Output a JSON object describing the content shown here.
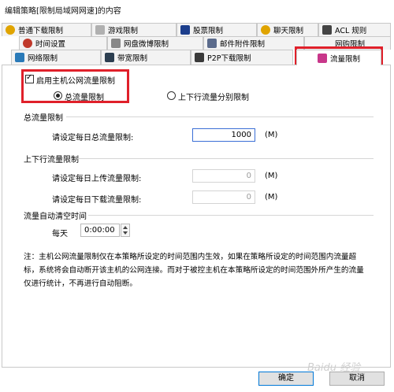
{
  "window": {
    "title": "编辑策略[限制局域网网速]的内容"
  },
  "tabs": {
    "row1": [
      {
        "label": "普通下载限制",
        "icon": "download-icon",
        "color": "#e0a400"
      },
      {
        "label": "游戏限制",
        "icon": "game-icon",
        "color": "#b0b0b0"
      },
      {
        "label": "股票限制",
        "icon": "stock-icon",
        "color": "#1c3e8c"
      },
      {
        "label": "聊天限制",
        "icon": "chat-icon",
        "color": "#e0a400"
      },
      {
        "label": "ACL 规则",
        "icon": "acl-icon",
        "color": "#444444"
      }
    ],
    "row2": [
      {
        "label": "时间设置",
        "icon": "clock-icon",
        "color": "#c0392b"
      },
      {
        "label": "网盘微博限制",
        "icon": "cloud-icon",
        "color": "#888888"
      },
      {
        "label": "邮件附件限制",
        "icon": "mail-icon",
        "color": "#5b6b8c"
      },
      {
        "label": "网购限制",
        "icon": "shop-icon",
        "color": "#5b6b8c"
      }
    ],
    "row3": [
      {
        "label": "网络限制",
        "icon": "network-icon",
        "color": "#2a7ab8"
      },
      {
        "label": "带宽限制",
        "icon": "bandwidth-icon",
        "color": "#2c3e50"
      },
      {
        "label": "P2P下载限制",
        "icon": "p2p-icon",
        "color": "#3a3a3a"
      },
      {
        "label": "流量限制",
        "icon": "traffic-icon",
        "color": "#c8378a"
      }
    ]
  },
  "main": {
    "enable_checkbox_label": "启用主机公网流量限制",
    "radio_total_label": "总流量限制",
    "radio_split_label": "上下行流量分别限制",
    "section_total": "总流量限制",
    "total_daily_label": "请设定每日总流量限制:",
    "total_daily_value": "1000",
    "unit": "(M)",
    "section_updown": "上下行流量限制",
    "upload_label": "请设定每日上传流量限制:",
    "upload_value": "0",
    "download_label": "请设定每日下载流量限制:",
    "download_value": "0",
    "section_auto_clear": "流量自动清空时间",
    "daily_label": "每天",
    "time_value": "0:00:00",
    "note": "注：主机公网流量限制仅在本策略所设定的时间范围内生效，如果在策略所设定的时间范围内流量超标，系统将会自动断开该主机的公网连接。而对于被控主机在本策略所设定的时间范围外所产生的流量仅进行统计，不再进行自动阻断。"
  },
  "footer": {
    "ok_label": "确定",
    "cancel_label": "取消"
  },
  "watermark": "Baidu 经验"
}
